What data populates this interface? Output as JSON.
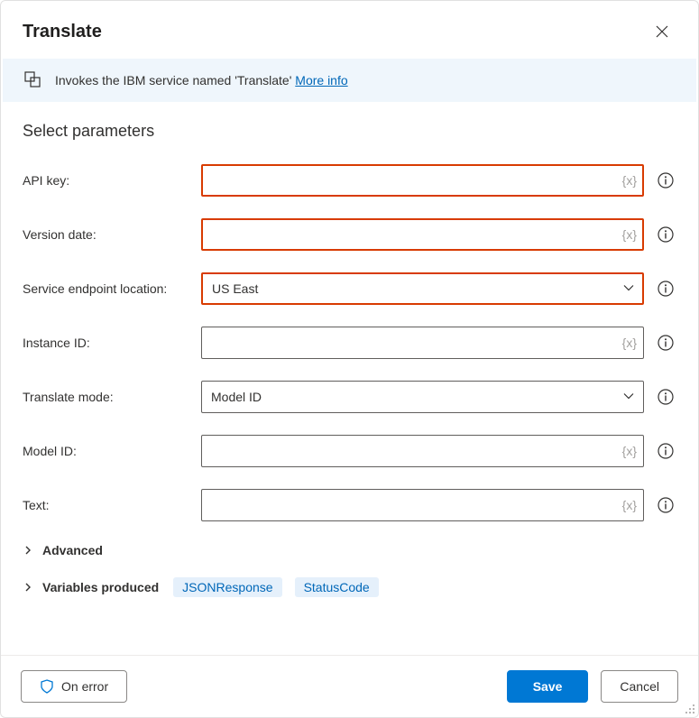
{
  "header": {
    "title": "Translate"
  },
  "banner": {
    "text": "Invokes the IBM service named 'Translate'",
    "link_label": "More info"
  },
  "section": {
    "title": "Select parameters"
  },
  "fields": {
    "api_key": {
      "label": "API key:",
      "value": "",
      "error": true
    },
    "version": {
      "label": "Version date:",
      "value": "",
      "error": true
    },
    "endpoint": {
      "label": "Service endpoint location:",
      "value": "US East",
      "error": true
    },
    "instance": {
      "label": "Instance ID:",
      "value": "",
      "error": false
    },
    "mode": {
      "label": "Translate mode:",
      "value": "Model ID",
      "error": false
    },
    "model": {
      "label": "Model ID:",
      "value": "",
      "error": false
    },
    "text": {
      "label": "Text:",
      "value": "",
      "error": false
    }
  },
  "advanced": {
    "label": "Advanced"
  },
  "variables": {
    "label": "Variables produced",
    "chips": [
      "JSONResponse",
      "StatusCode"
    ]
  },
  "footer": {
    "on_error": "On error",
    "save": "Save",
    "cancel": "Cancel"
  },
  "tokens": {
    "var_placeholder": "{x}"
  }
}
